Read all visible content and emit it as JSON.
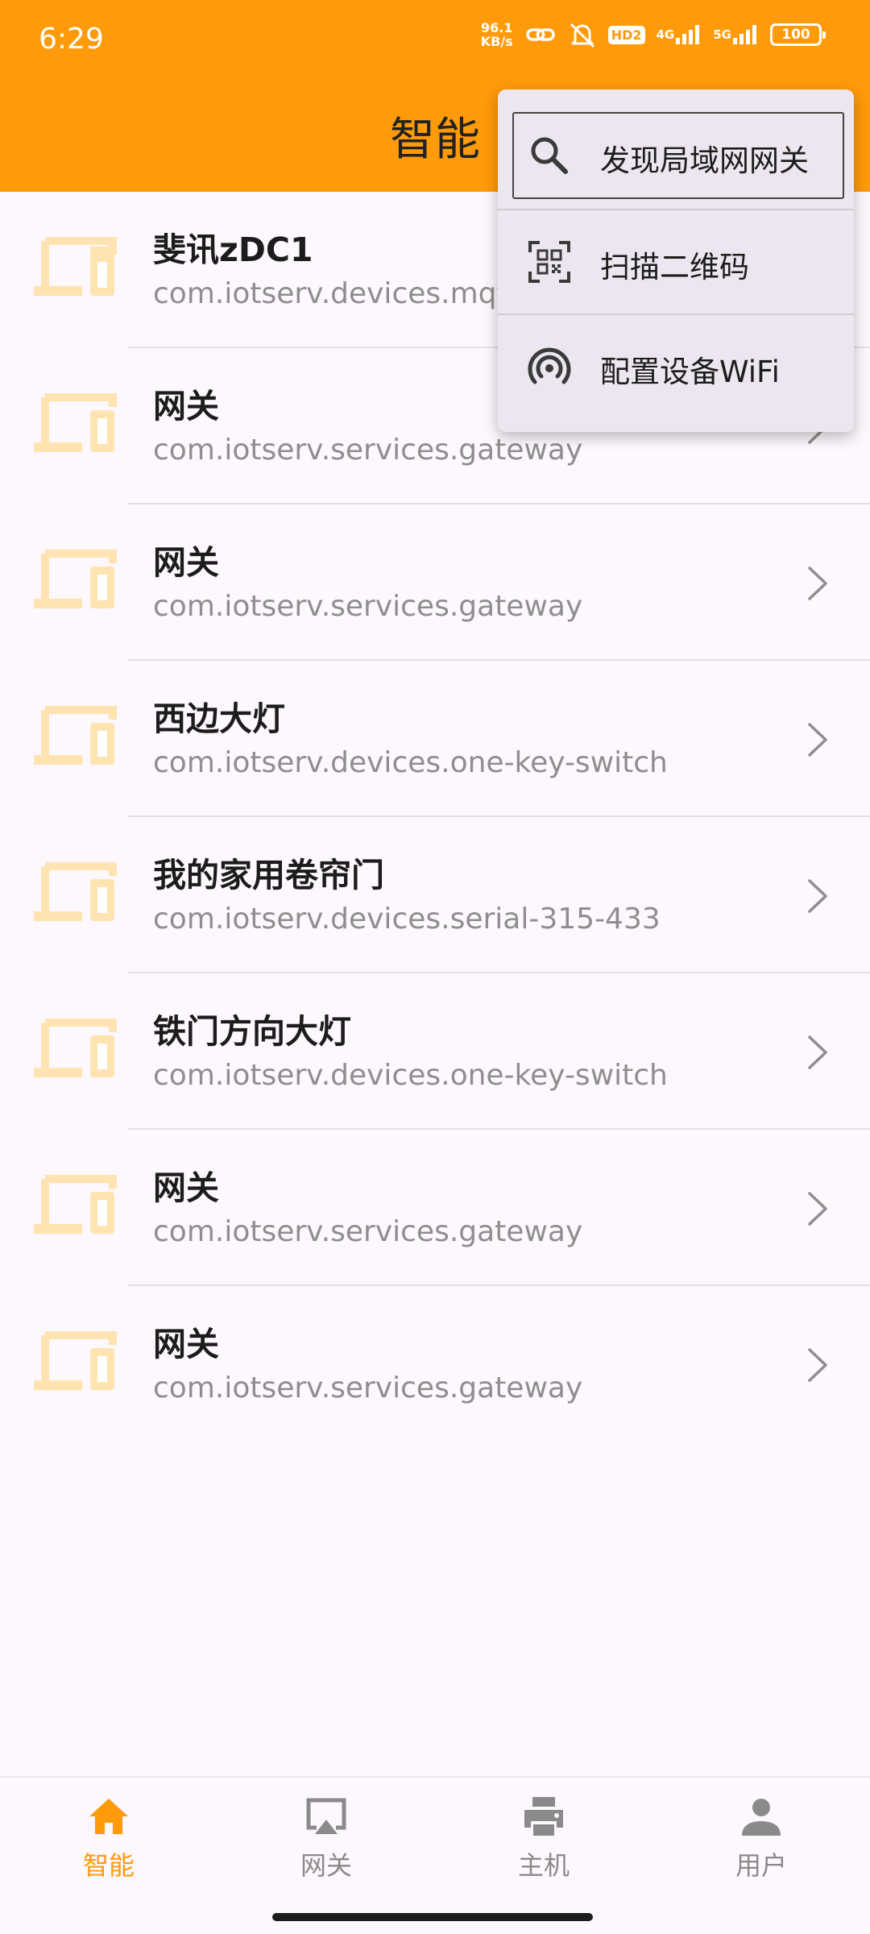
{
  "status_bar": {
    "time": "6:29",
    "net_speed_value": "96.1",
    "net_speed_unit": "KB/s",
    "hd_badge": "HD2",
    "net_4g": "4G",
    "net_5g": "5G",
    "battery": "100"
  },
  "app_bar": {
    "title": "智能"
  },
  "devices": [
    {
      "name": "斐讯zDC1",
      "id": "com.iotserv.devices.mqtt"
    },
    {
      "name": "网关",
      "id": "com.iotserv.services.gateway"
    },
    {
      "name": "网关",
      "id": "com.iotserv.services.gateway"
    },
    {
      "name": "西边大灯",
      "id": "com.iotserv.devices.one-key-switch"
    },
    {
      "name": "我的家用卷帘门",
      "id": "com.iotserv.devices.serial-315-433"
    },
    {
      "name": "铁门方向大灯",
      "id": "com.iotserv.devices.one-key-switch"
    },
    {
      "name": "网关",
      "id": "com.iotserv.services.gateway"
    },
    {
      "name": "网关",
      "id": "com.iotserv.services.gateway"
    }
  ],
  "menu": {
    "items": [
      {
        "label": "发现局域网网关",
        "icon": "search-icon"
      },
      {
        "label": "扫描二维码",
        "icon": "qr-scan-icon"
      },
      {
        "label": "配置设备WiFi",
        "icon": "wifi-broadcast-icon"
      }
    ]
  },
  "bottom_nav": {
    "items": [
      {
        "label": "智能",
        "icon": "home-icon",
        "active": true
      },
      {
        "label": "网关",
        "icon": "airplay-icon",
        "active": false
      },
      {
        "label": "主机",
        "icon": "printer-icon",
        "active": false
      },
      {
        "label": "用户",
        "icon": "person-icon",
        "active": false
      }
    ]
  },
  "colors": {
    "accent": "#ff9a0a",
    "device_icon": "#ffe3b0",
    "menu_bg": "#ece6f0",
    "background": "#fdf8fd"
  }
}
